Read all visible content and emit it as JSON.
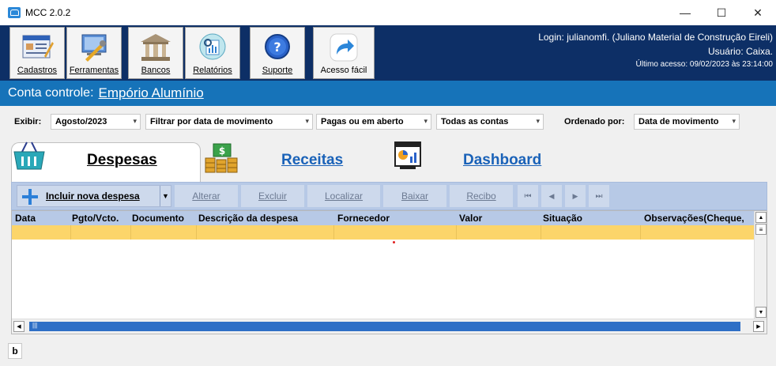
{
  "window": {
    "title": "MCC 2.0.2",
    "controls": [
      "—",
      "☐",
      "✕"
    ]
  },
  "toolbar": [
    {
      "label": "Cadastros",
      "underline_char": "C",
      "icon": "cadastros-icon"
    },
    {
      "label": "Ferramentas",
      "underline_char": "F",
      "icon": "ferramentas-icon"
    },
    {
      "label": "Bancos",
      "underline_char": "B",
      "icon": "bank-icon"
    },
    {
      "label": "Relatórios",
      "underline_char": "R",
      "icon": "report-icon"
    },
    {
      "label": "Suporte",
      "underline_char": "S",
      "icon": "help-icon"
    },
    {
      "label": "Acesso fácil",
      "underline_char": "",
      "icon": "share-arrow-icon"
    }
  ],
  "login": {
    "line1": "Login: julianomfi. (Juliano Material de Construção Eireli)",
    "line2": "Usuário: Caixa.",
    "line3": "Último acesso: 09/02/2023 às 23:14:00"
  },
  "conta": {
    "label": "Conta controle:",
    "value": "Empório Alumínio"
  },
  "filters": {
    "exibir_label": "Exibir:",
    "periodo": "Agosto/2023",
    "filtro": "Filtrar por data de movimento",
    "status": "Pagas ou em aberto",
    "contas": "Todas as contas",
    "ordenado_label": "Ordenado por:",
    "ordenacao": "Data de movimento"
  },
  "tabs": [
    {
      "label": "Despesas",
      "icon": "basket-icon",
      "selected": true
    },
    {
      "label": "Receitas",
      "icon": "money-stack-icon",
      "selected": false
    },
    {
      "label": "Dashboard",
      "icon": "dashboard-icon",
      "selected": false
    }
  ],
  "actions": {
    "incluir": "Incluir nova despesa",
    "alterar": "Alterar",
    "excluir": "Excluir",
    "localizar": "Localizar",
    "baixar": "Baixar",
    "recibo": "Recibo",
    "nav_first": "⏮",
    "nav_prev": "◀",
    "nav_next": "▶",
    "nav_last": "⏭"
  },
  "grid": {
    "columns": [
      "Data",
      "Pgto/Vcto.",
      "Documento",
      "Descrição da despesa",
      "Fornecedor",
      "Valor",
      "Situação",
      "Observações(Cheque,"
    ],
    "scroll_thumb_label": "|||"
  },
  "status": {
    "badge": "b"
  },
  "colors": {
    "toolbar_bg": "#0d2f66",
    "conta_bg": "#1673b9",
    "action_bar_bg": "#b7c9e6",
    "selected_row": "#fcd56a"
  }
}
